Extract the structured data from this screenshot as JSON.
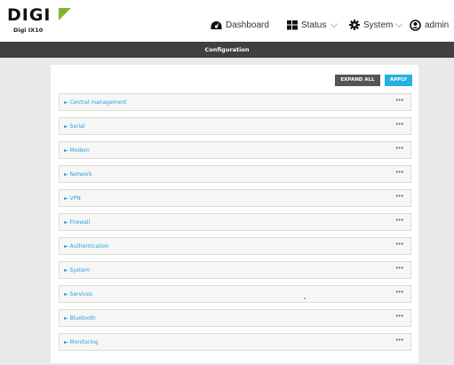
{
  "brand": {
    "logo_text": "DIGI",
    "device": "Digi IX10",
    "accent": "#7ab929"
  },
  "nav": {
    "dashboard": "Dashboard",
    "status": "Status",
    "system": "System",
    "user": "admin"
  },
  "page_title": "Configuration",
  "actions": {
    "expand_all": "EXPAND ALL",
    "apply": "APPLY"
  },
  "sections": [
    {
      "label": "► Central management",
      "more": "•••"
    },
    {
      "label": "► Serial",
      "more": "•••"
    },
    {
      "label": "► Modem",
      "more": "•••"
    },
    {
      "label": "► Network",
      "more": "•••"
    },
    {
      "label": "► VPN",
      "more": "•••"
    },
    {
      "label": "► Firewall",
      "more": "•••"
    },
    {
      "label": "► Authentication",
      "more": "•••"
    },
    {
      "label": "► System",
      "more": "•••"
    },
    {
      "label": "► Services",
      "more": "•••"
    },
    {
      "label": "► Bluetooth",
      "more": "•••"
    },
    {
      "label": "► Monitoring",
      "more": "•••"
    }
  ],
  "colors": {
    "link": "#2f9fd8",
    "apply": "#26b0e4",
    "expand": "#555555",
    "header": "#404040"
  }
}
